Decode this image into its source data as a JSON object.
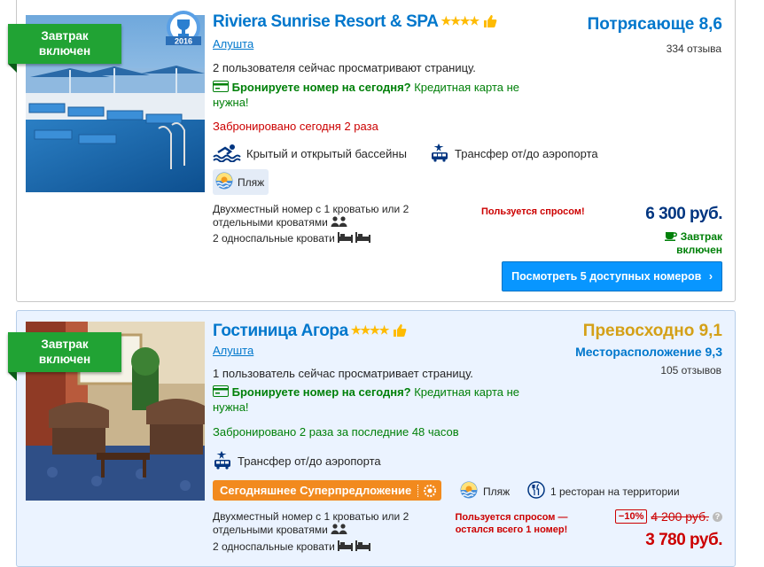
{
  "hotels": [
    {
      "ribbon_line1": "Завтрак",
      "ribbon_line2": "включен",
      "award_year": "2016",
      "name": "Riviera Sunrise Resort & SPA",
      "stars": "★★★★",
      "city": "Алушта",
      "score_label": "Потрясающе 8,6",
      "reviews": "334 отзыва",
      "viewers": "2 пользователя сейчас просматривают страницу.",
      "book_today_bold": "Бронируете номер на сегодня?",
      "book_today_rest": " Кредитная карта не нужна!",
      "booked": "Забронировано сегодня 2 раза",
      "facility1": "Крытый и открытый бассейны",
      "facility2": "Трансфер от/до аэропорта",
      "badge_beach": "Пляж",
      "room_type": "Двухместный номер с 1 кроватью или 2 отдельными кроватями",
      "beds": "2 односпальные кровати",
      "demand": "Пользуется спросом!",
      "price": "6 300 руб.",
      "breakfast_note_line1": "Завтрак",
      "breakfast_note_line2": "включен",
      "cta": "Посмотреть 5 доступных номеров",
      "score_color": "#0077cc"
    },
    {
      "ribbon_line1": "Завтрак",
      "ribbon_line2": "включен",
      "name": "Гостиница Агора",
      "stars": "★★★★",
      "city": "Алушта",
      "score_label": "Превосходно 9,1",
      "location_score": "Месторасположение 9,3",
      "reviews": "105 отзывов",
      "viewers": "1 пользователь сейчас просматривает страницу.",
      "book_today_bold": "Бронируете номер на сегодня?",
      "book_today_rest": " Кредитная карта не нужна!",
      "booked": "Забронировано 2 раза за последние 48 часов",
      "facility1": "Трансфер от/до аэропорта",
      "promo": "Сегодняшнее Суперпредложение",
      "badge_beach": "Пляж",
      "badge_restaurant": "1 ресторан на территории",
      "room_type": "Двухместный номер с 1 кроватью или 2 отдельными кроватями",
      "beds": "2 односпальные кровати",
      "demand_line1": "Пользуется спросом —",
      "demand_line2": "остался всего 1 номер!",
      "discount": "−10%",
      "old_price": "4 200 руб.",
      "price": "3 780 руб.",
      "score_color": "#d4a017"
    }
  ]
}
